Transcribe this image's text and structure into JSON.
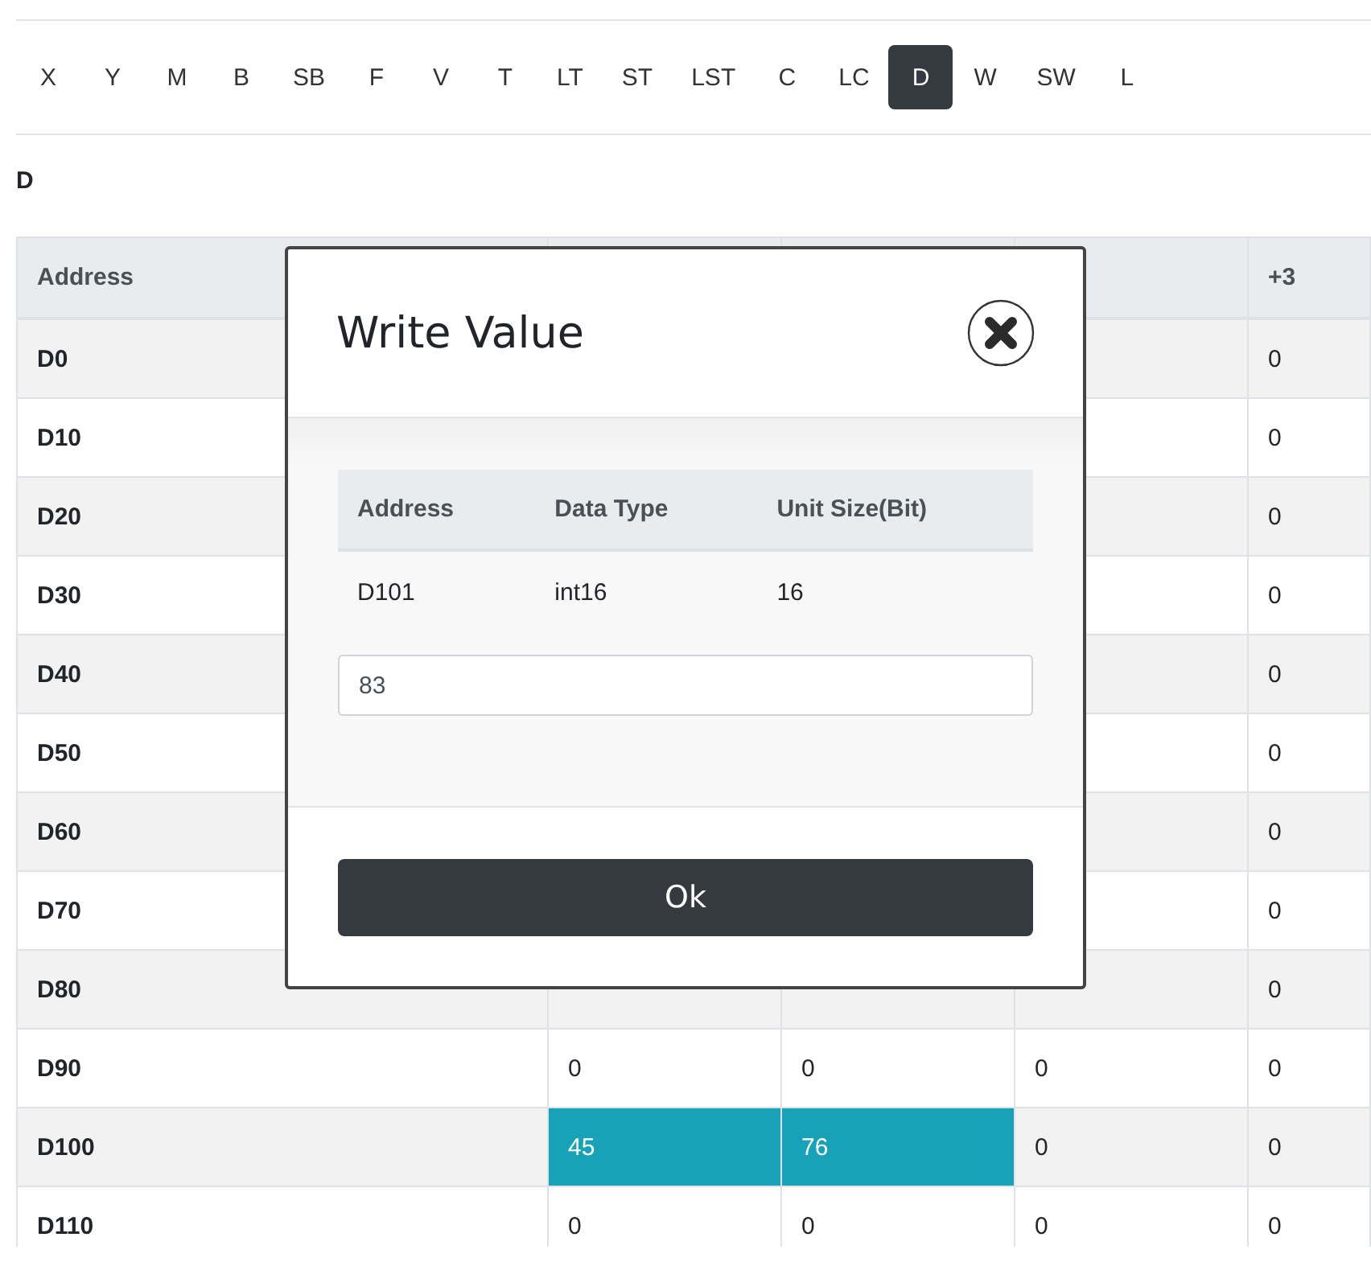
{
  "tabs": [
    {
      "label": "X",
      "selected": false
    },
    {
      "label": "Y",
      "selected": false
    },
    {
      "label": "M",
      "selected": false
    },
    {
      "label": "B",
      "selected": false
    },
    {
      "label": "SB",
      "selected": false
    },
    {
      "label": "F",
      "selected": false
    },
    {
      "label": "V",
      "selected": false
    },
    {
      "label": "T",
      "selected": false
    },
    {
      "label": "LT",
      "selected": false
    },
    {
      "label": "ST",
      "selected": false
    },
    {
      "label": "LST",
      "selected": false
    },
    {
      "label": "C",
      "selected": false
    },
    {
      "label": "LC",
      "selected": false
    },
    {
      "label": "D",
      "selected": true
    },
    {
      "label": "W",
      "selected": false
    },
    {
      "label": "SW",
      "selected": false
    },
    {
      "label": "L",
      "selected": false
    }
  ],
  "section_title": "D",
  "table": {
    "columns": [
      "Address",
      null,
      null,
      null,
      "+3"
    ],
    "rows": [
      {
        "cells": [
          {
            "value": "D0",
            "highlighted": false
          },
          null,
          null,
          null,
          {
            "value": "0",
            "highlighted": false
          }
        ]
      },
      {
        "cells": [
          {
            "value": "D10",
            "highlighted": false
          },
          null,
          null,
          null,
          {
            "value": "0",
            "highlighted": false
          }
        ]
      },
      {
        "cells": [
          {
            "value": "D20",
            "highlighted": false
          },
          null,
          null,
          null,
          {
            "value": "0",
            "highlighted": false
          }
        ]
      },
      {
        "cells": [
          {
            "value": "D30",
            "highlighted": false
          },
          null,
          null,
          null,
          {
            "value": "0",
            "highlighted": false
          }
        ]
      },
      {
        "cells": [
          {
            "value": "D40",
            "highlighted": false
          },
          null,
          null,
          null,
          {
            "value": "0",
            "highlighted": false
          }
        ]
      },
      {
        "cells": [
          {
            "value": "D50",
            "highlighted": false
          },
          null,
          null,
          null,
          {
            "value": "0",
            "highlighted": false
          }
        ]
      },
      {
        "cells": [
          {
            "value": "D60",
            "highlighted": false
          },
          null,
          null,
          null,
          {
            "value": "0",
            "highlighted": false
          }
        ]
      },
      {
        "cells": [
          {
            "value": "D70",
            "highlighted": false
          },
          null,
          null,
          null,
          {
            "value": "0",
            "highlighted": false
          }
        ]
      },
      {
        "cells": [
          {
            "value": "D80",
            "highlighted": false
          },
          null,
          null,
          null,
          {
            "value": "0",
            "highlighted": false
          }
        ]
      },
      {
        "cells": [
          {
            "value": "D90",
            "highlighted": false
          },
          {
            "value": "0",
            "highlighted": false
          },
          {
            "value": "0",
            "highlighted": false
          },
          {
            "value": "0",
            "highlighted": false
          },
          {
            "value": "0",
            "highlighted": false
          }
        ]
      },
      {
        "cells": [
          {
            "value": "D100",
            "highlighted": false
          },
          {
            "value": "45",
            "highlighted": true
          },
          {
            "value": "76",
            "highlighted": true
          },
          {
            "value": "0",
            "highlighted": false
          },
          {
            "value": "0",
            "highlighted": false
          }
        ]
      },
      {
        "cells": [
          {
            "value": "D110",
            "highlighted": false
          },
          {
            "value": "0",
            "highlighted": false
          },
          {
            "value": "0",
            "highlighted": false
          },
          {
            "value": "0",
            "highlighted": false
          },
          {
            "value": "0",
            "highlighted": false
          }
        ]
      }
    ]
  },
  "dialog": {
    "title": "Write Value",
    "columns": [
      "Address",
      "Data Type",
      "Unit Size(Bit)"
    ],
    "row": [
      "D101",
      "int16",
      "16"
    ],
    "value": "83",
    "button": "Ok"
  }
}
